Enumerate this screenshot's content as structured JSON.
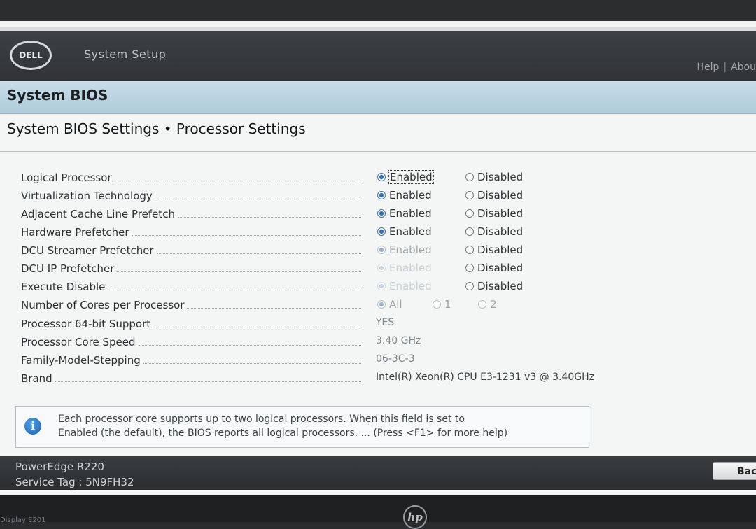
{
  "header": {
    "logo_text": "DELL",
    "app_title": "System Setup",
    "links": [
      "Help",
      "Abou"
    ]
  },
  "bios_title": "System BIOS",
  "section_title": "System BIOS Settings • Processor Settings",
  "settings": [
    {
      "label": "Logical Processor",
      "type": "radio",
      "options": [
        "Enabled",
        "Disabled"
      ],
      "selected": "Enabled"
    },
    {
      "label": "Virtualization Technology",
      "type": "radio",
      "options": [
        "Enabled",
        "Disabled"
      ],
      "selected": "Enabled"
    },
    {
      "label": "Adjacent Cache Line Prefetch",
      "type": "radio",
      "options": [
        "Enabled",
        "Disabled"
      ],
      "selected": "Enabled"
    },
    {
      "label": "Hardware Prefetcher",
      "type": "radio",
      "options": [
        "Enabled",
        "Disabled"
      ],
      "selected": "Enabled"
    },
    {
      "label": "DCU Streamer Prefetcher",
      "type": "radio",
      "options": [
        "Enabled",
        "Disabled"
      ],
      "selected": "Enabled"
    },
    {
      "label": "DCU IP Prefetcher",
      "type": "radio",
      "options": [
        "Enabled",
        "Disabled"
      ],
      "selected": "Enabled"
    },
    {
      "label": "Execute Disable",
      "type": "radio",
      "options": [
        "Enabled",
        "Disabled"
      ],
      "selected": "Enabled"
    },
    {
      "label": "Number of Cores per Processor",
      "type": "radio",
      "options": [
        "All",
        "1",
        "2"
      ],
      "selected": "All"
    },
    {
      "label": "Processor 64-bit Support",
      "type": "value",
      "value": "YES"
    },
    {
      "label": "Processor Core Speed",
      "type": "value",
      "value": "3.40 GHz"
    },
    {
      "label": "Family-Model-Stepping",
      "type": "value",
      "value": "06-3C-3"
    },
    {
      "label": "Brand",
      "type": "value",
      "value": "Intel(R) Xeon(R) CPU E3-1231 v3 @ 3.40GHz"
    }
  ],
  "help": {
    "icon": "info-icon",
    "line1": "Each processor core supports up to two logical processors. When this field is set to",
    "line2": "Enabled (the default), the BIOS reports all logical processors. ... (Press <F1> for more help)"
  },
  "footer": {
    "model": "PowerEdge R220",
    "service_tag": "Service Tag : 5N9FH32",
    "back_button": "Bac"
  },
  "bezel": {
    "brand_logo": "hp",
    "model_text": "Display E201"
  },
  "colors": {
    "header": "#2f3133",
    "bios_bar": "#aecbdb",
    "radio_selected": "#2f6fc1",
    "background": "#f4f6f5"
  }
}
